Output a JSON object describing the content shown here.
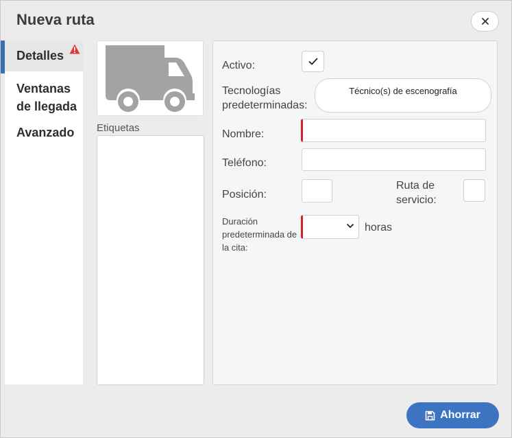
{
  "dialog": {
    "title": "Nueva ruta"
  },
  "tabs": [
    {
      "label": "Detalles"
    },
    {
      "label": "Ventanas de llegada"
    },
    {
      "label": "Avanzado"
    }
  ],
  "left_panel": {
    "tags_label": "Etiquetas"
  },
  "form": {
    "active_label": "Activo:",
    "active_checked": true,
    "technologies_label": "Tecnologías predeterminadas:",
    "technologies_value": "Técnico(s) de escenografía",
    "name_label": "Nombre:",
    "name_value": "",
    "phone_label": "Teléfono:",
    "phone_value": "",
    "position_label": "Posición:",
    "position_value": "",
    "service_route_label": "Ruta de servicio:",
    "duration_label": "Duración predeterminada de la cita:",
    "duration_value": "",
    "duration_unit": "horas"
  },
  "footer": {
    "save_label": "Ahorrar"
  },
  "colors": {
    "accent": "#3d74c2",
    "required": "#d6202a",
    "warning": "#e03a3a",
    "truck": "#a3a3a3"
  }
}
